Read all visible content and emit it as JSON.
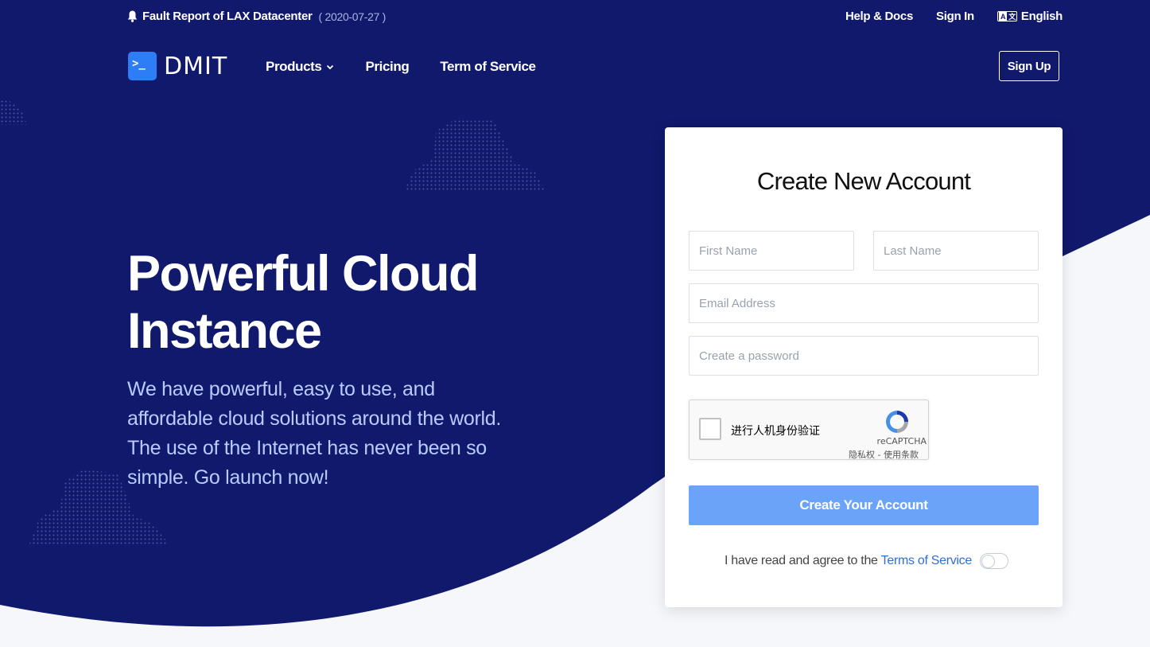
{
  "colors": {
    "navy": "#10196b",
    "accent": "#2d7df6",
    "button": "#6aa3f8",
    "link": "#2e6fd6"
  },
  "topbar": {
    "notice_text": "Fault Report of LAX Datacenter",
    "notice_date": "( 2020-07-27 )",
    "links": [
      "Help & Docs",
      "Sign In",
      "English"
    ]
  },
  "nav": {
    "logo_text": "DMIT",
    "logo_mark": ">_",
    "menu": [
      "Products",
      "Pricing",
      "Term of Service"
    ],
    "signup_label": "Sign Up"
  },
  "hero": {
    "title_line1": "Powerful Cloud",
    "title_line2": "Instance",
    "subtitle": "We have powerful, easy to use, and affordable cloud solutions around the world. The use of the Internet has never been so simple. Go launch now!"
  },
  "form": {
    "title": "Create New Account",
    "first_name_placeholder": "First Name",
    "last_name_placeholder": "Last Name",
    "email_placeholder": "Email Address",
    "password_placeholder": "Create a password",
    "captcha_label": "进行人机身份验证",
    "captcha_brand": "reCAPTCHA",
    "captcha_privacy": "隐私权",
    "captcha_sep": " - ",
    "captcha_terms": "使用条款",
    "submit_label": "Create Your Account",
    "agree_text": "I have read and agree to the",
    "agree_link": "Terms of Service"
  }
}
